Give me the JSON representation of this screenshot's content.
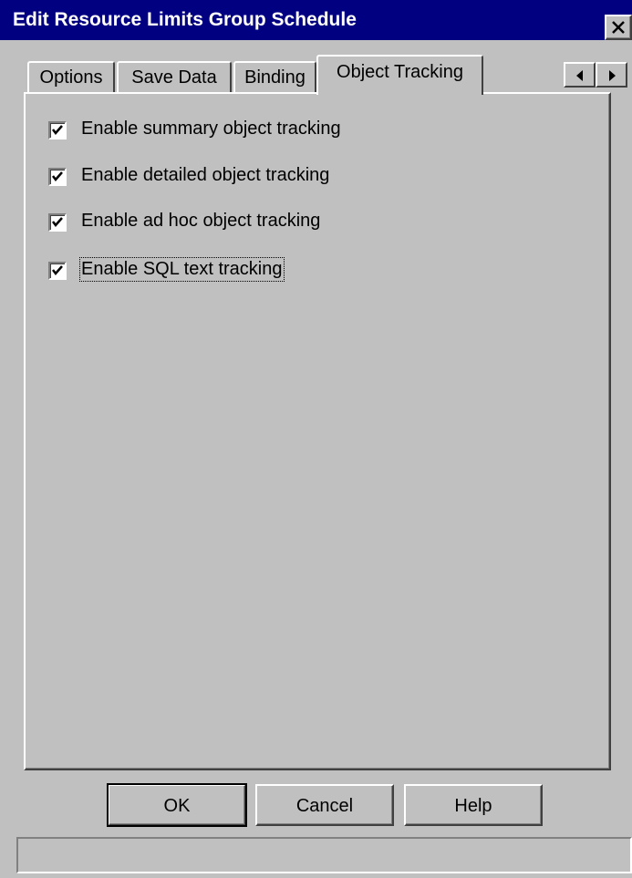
{
  "window": {
    "title": "Edit Resource Limits Group Schedule",
    "close_icon": "close-icon"
  },
  "tabs": [
    {
      "label": "Options",
      "active": false
    },
    {
      "label": "Save Data",
      "active": false
    },
    {
      "label": "Binding",
      "active": false
    },
    {
      "label": "Object Tracking",
      "active": true
    }
  ],
  "tab_scroll": {
    "left_icon": "arrow-left-icon",
    "right_icon": "arrow-right-icon"
  },
  "options": [
    {
      "label": "Enable summary object tracking",
      "checked": true
    },
    {
      "label": "Enable detailed object tracking",
      "checked": true
    },
    {
      "label": "Enable ad hoc object tracking",
      "checked": true
    },
    {
      "label": "Enable SQL text tracking",
      "checked": true,
      "focused": true
    }
  ],
  "buttons": {
    "ok": "OK",
    "cancel": "Cancel",
    "help": "Help"
  },
  "status": ""
}
